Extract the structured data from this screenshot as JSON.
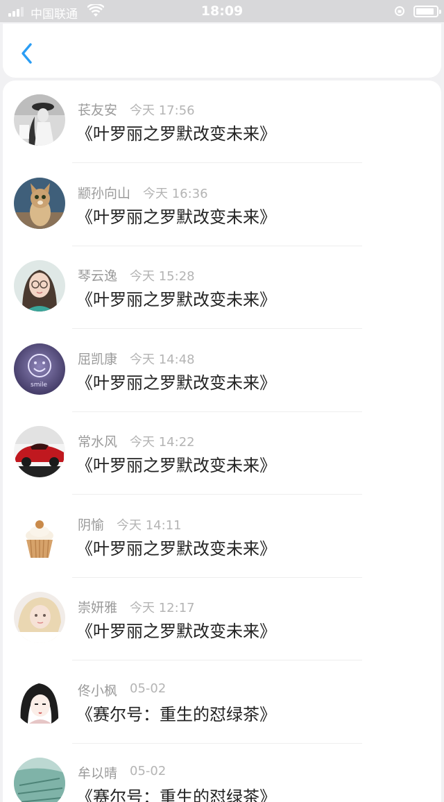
{
  "status_bar": {
    "carrier": "中国联通",
    "time": "18:09",
    "signal_bars_filled": 3,
    "battery_level": 0.9
  },
  "nav": {
    "back_icon": "chevron-left-icon",
    "accent_color": "#2a9df4"
  },
  "messages": [
    {
      "name": "苌友安",
      "time": "今天 17:56",
      "title": "《叶罗丽之罗默改变未来》",
      "avatar": "girl-hat-photo"
    },
    {
      "name": "颛孙向山",
      "time": "今天 16:36",
      "title": "《叶罗丽之罗默改变未来》",
      "avatar": "cat-photo"
    },
    {
      "name": "琴云逸",
      "time": "今天 15:28",
      "title": "《叶罗丽之罗默改变未来》",
      "avatar": "girl-glasses-photo"
    },
    {
      "name": "屈凯康",
      "time": "今天 14:48",
      "title": "《叶罗丽之罗默改变未来》",
      "avatar": "smiley-photo"
    },
    {
      "name": "常水风",
      "time": "今天 14:22",
      "title": "《叶罗丽之罗默改变未来》",
      "avatar": "red-car-photo"
    },
    {
      "name": "阴愉",
      "time": "今天 14:11",
      "title": "《叶罗丽之罗默改变未来》",
      "avatar": "cupcake-photo"
    },
    {
      "name": "崇妍雅",
      "time": "今天 12:17",
      "title": "《叶罗丽之罗默改变未来》",
      "avatar": "blonde-girl-photo"
    },
    {
      "name": "佟小枫",
      "time": "05-02",
      "title": "《赛尔号：重生的怼绿茶》",
      "avatar": "anime-girl-drawing"
    },
    {
      "name": "牟以晴",
      "time": "05-02",
      "title": "《赛尔号：重生的怼绿茶》",
      "avatar": "teal-photo"
    }
  ]
}
